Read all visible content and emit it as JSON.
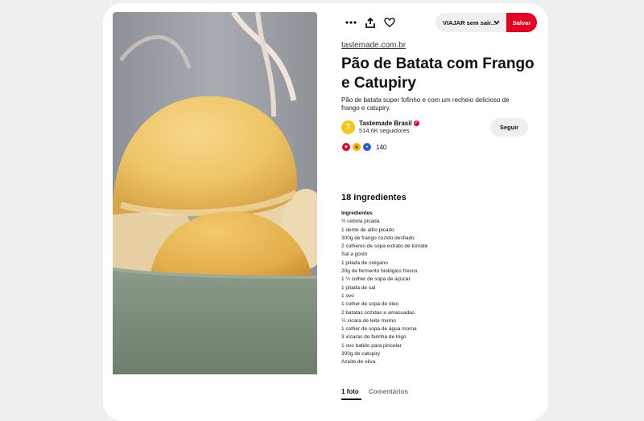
{
  "toolbar": {
    "more_icon": "more-icon",
    "share_icon": "share-icon",
    "like_icon": "heart-icon",
    "board_select": "VIAJAR sem sair...",
    "save_label": "Salvar"
  },
  "pin": {
    "source": "tastemade.com.br",
    "title": "Pão de Batata com Frango e Catupiry",
    "description": "Pão de batata super fofinho e com um recheio delicioso de frango e catupiry."
  },
  "author": {
    "name": "Tastemade Brasil",
    "followers": "514,6K seguidores",
    "follow_label": "Seguir",
    "avatar_glyph": "T"
  },
  "reactions": {
    "icons": [
      "heart",
      "wow",
      "good-idea"
    ],
    "count": "140"
  },
  "ingredients": {
    "heading": "18 ingredientes",
    "section": "Ingredientes",
    "items": [
      "½ cebola picada",
      "1 dente de alho picado",
      "300g de frango cozido desfiado",
      "2 colheres de sopa extrato de tomate",
      "Sal a gosto",
      "1 pitada de orégano",
      "20g de fermento biológico fresco",
      "1 ½ colher de sopa de açúcar",
      "1 pitada de sal",
      "1 ovo",
      "1 colher de sopa de óleo",
      "2 batatas cozidas e amassadas",
      "½ xícara de leite morno",
      "1 colher de sopa de água morna",
      "3 xícaras de farinha de trigo",
      "1 ovo batido para pincelar",
      "300g de catupiry",
      "Azeite de oliva"
    ]
  },
  "tabs": [
    {
      "label": "1 foto"
    },
    {
      "label": "Comentários"
    }
  ],
  "colors": {
    "accent": "#e60023",
    "background": "#efefef",
    "bowl": "#7e907e"
  }
}
